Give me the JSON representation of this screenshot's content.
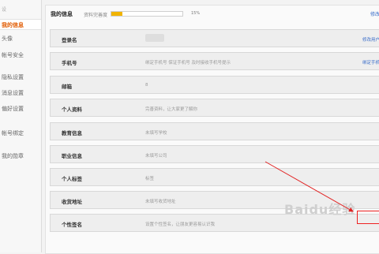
{
  "sidebar": {
    "header": "设",
    "items": [
      {
        "label": "我的信息",
        "active": true
      },
      {
        "label": "头像",
        "active": false
      },
      {
        "label": "帐号安全",
        "active": false
      },
      {
        "label": "隐私设置",
        "active": false
      },
      {
        "label": "消息设置",
        "active": false
      },
      {
        "label": "偏好设置",
        "active": false
      },
      {
        "label": "帐号绑定",
        "active": false
      },
      {
        "label": "我的勋章",
        "active": false
      }
    ]
  },
  "header": {
    "title": "我的信息",
    "progress_label": "资料完善度",
    "progress_percent_text": "15%",
    "progress_value": 0.15,
    "link": "修改"
  },
  "rows": [
    {
      "label": "登录名",
      "value": "",
      "action": "修改用户"
    },
    {
      "label": "手机号",
      "value": "绑定手机号 保证手机号 及时接收手机号提示",
      "action": "绑定手机"
    },
    {
      "label": "邮箱",
      "value": "8",
      "action": ""
    },
    {
      "label": "个人资料",
      "value": "完善资料，让大家更了解你",
      "action": ""
    },
    {
      "label": "教育信息",
      "value": "未填写学校",
      "action": ""
    },
    {
      "label": "职业信息",
      "value": "未填写公司",
      "action": ""
    },
    {
      "label": "个人标签",
      "value": "标签",
      "action": ""
    },
    {
      "label": "收货地址",
      "value": "未填写收货地址",
      "action": ""
    },
    {
      "label": "个性签名",
      "value": "设置个性签名，让朋友更容易认识我",
      "action": ""
    }
  ],
  "watermark": "Baidu经验",
  "colors": {
    "accent": "#e05a00",
    "link": "#3a6dc9",
    "progress": "#f1b400",
    "annotation": "#e22222"
  }
}
